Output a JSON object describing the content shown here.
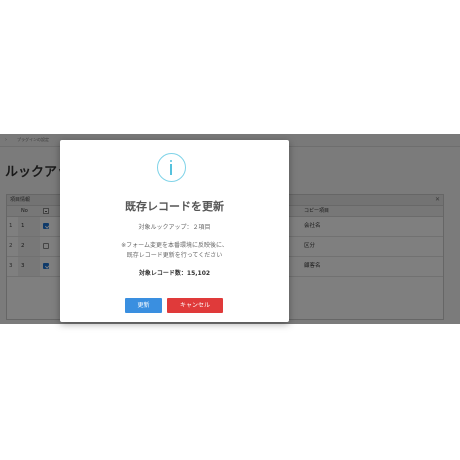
{
  "background": {
    "breadcrumb": "プラグインの設定",
    "page_title": "ルックアップ",
    "panel_title": "項目情報",
    "panel_close": "✕",
    "headers": {
      "no": "No",
      "copy": "コピー項目"
    },
    "rows": [
      {
        "rownum": "1",
        "no": "1",
        "checked": true,
        "copy": "会社名"
      },
      {
        "rownum": "2",
        "no": "2",
        "checked": false,
        "copy": "区分"
      },
      {
        "rownum": "3",
        "no": "3",
        "checked": true,
        "copy": "顧客名"
      }
    ]
  },
  "dialog": {
    "icon": "info-icon",
    "title": "既存レコードを更新",
    "target_label": "対象ルックアップ：２項目",
    "note_line1": "※フォーム変更を本番環境に反映後に、",
    "note_line2": "既存レコード更新を行ってください",
    "record_count": "対象レコード数：15,102",
    "update_button": "更新",
    "cancel_button": "キャンセル"
  },
  "colors": {
    "update": "#3a8fe0",
    "cancel": "#e03a3a",
    "info_icon": "#56c2dd",
    "checkbox": "#1e74d4"
  }
}
